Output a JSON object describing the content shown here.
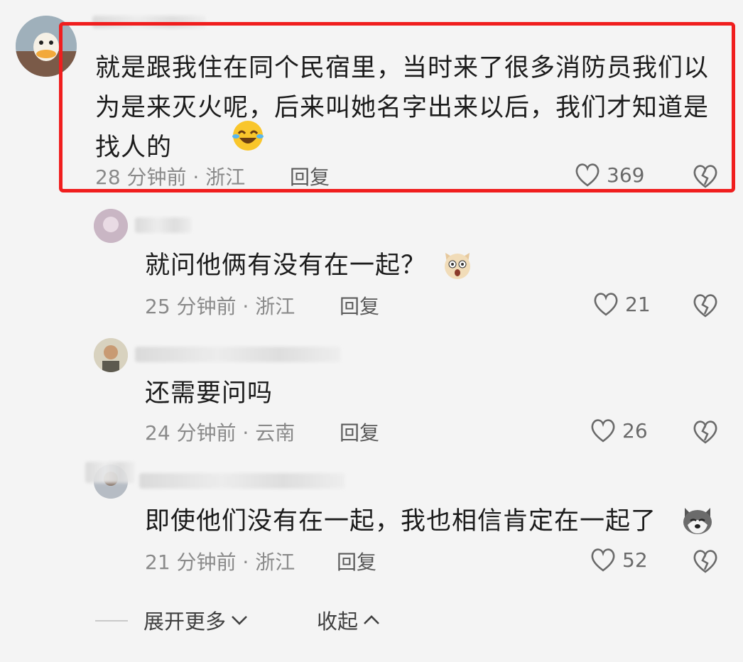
{
  "comment1": {
    "text": "就是跟我住在同个民宿里，当时来了很多消防员我们以为是来灭火呢，后来叫她名字出来以后，我们才知道是找人的",
    "time": "28 分钟前 · 浙江",
    "reply": "回复",
    "likes": "369"
  },
  "comment2": {
    "text": "就问他俩有没有在一起？",
    "time": "25 分钟前 · 浙江",
    "reply": "回复",
    "likes": "21"
  },
  "comment3": {
    "text": "还需要问吗",
    "time": "24 分钟前 · 云南",
    "reply": "回复",
    "likes": "26"
  },
  "comment4": {
    "text": "即使他们没有在一起，我也相信肯定在一起了",
    "time": "21 分钟前 · 浙江",
    "reply": "回复",
    "likes": "52"
  },
  "footer": {
    "expand": "展开更多",
    "collapse": "收起"
  },
  "colors": {
    "highlight": "#f01e1e",
    "meta": "#8a8a8a"
  },
  "icons": [
    "heart-outline-icon",
    "broken-heart-icon",
    "chevron-down-icon",
    "chevron-up-icon",
    "laughing-tears-emoji",
    "surprised-dog-emoji",
    "husky-emoji"
  ]
}
